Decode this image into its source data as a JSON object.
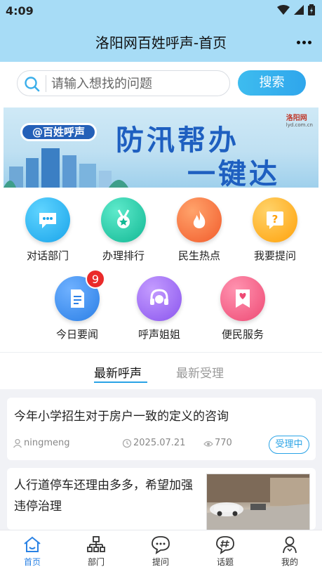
{
  "status_bar": {
    "time": "4:09"
  },
  "header": {
    "title": "洛阳网百姓呼声-首页"
  },
  "search": {
    "placeholder": "请输入想找的问题",
    "button_label": "搜索"
  },
  "banner": {
    "tag": "@百姓呼声",
    "headline_line1": "防汛帮办",
    "headline_line2": "一键达",
    "logo_text": "洛阳网",
    "logo_sub": "lyd.com.cn"
  },
  "grid": {
    "items": [
      {
        "label": "对话部门",
        "icon": "chat-bubble-icon",
        "color": "#2cb8f0"
      },
      {
        "label": "办理排行",
        "icon": "medal-icon",
        "color": "#22c7a8"
      },
      {
        "label": "民生热点",
        "icon": "flame-icon",
        "color": "#ff7a3d"
      },
      {
        "label": "我要提问",
        "icon": "question-icon",
        "color": "#ffb21e"
      },
      {
        "label": "今日要闻",
        "icon": "document-icon",
        "color": "#3d8ff0",
        "badge": "9"
      },
      {
        "label": "呼声姐姐",
        "icon": "headset-icon",
        "color": "#9b6bf2"
      },
      {
        "label": "便民服务",
        "icon": "heart-card-icon",
        "color": "#f45a82"
      }
    ]
  },
  "tabs": {
    "active": "最新呼声",
    "inactive": "最新受理"
  },
  "posts": [
    {
      "title": "今年小学招生对于房户一致的定义的咨询",
      "author": "ningmeng",
      "date": "2025.07.21",
      "views": "770",
      "status": "受理中"
    },
    {
      "title": "人行道停车还理由多多，希望加强违停治理"
    }
  ],
  "bottom_nav": {
    "items": [
      {
        "label": "首页",
        "active": true
      },
      {
        "label": "部门"
      },
      {
        "label": "提问"
      },
      {
        "label": "话题"
      },
      {
        "label": "我的"
      }
    ]
  },
  "colors": {
    "header_bg": "#a7dcf6",
    "accent": "#2aa3e6",
    "nav_active": "#2a82e4",
    "badge_red": "#ea2a2a"
  }
}
